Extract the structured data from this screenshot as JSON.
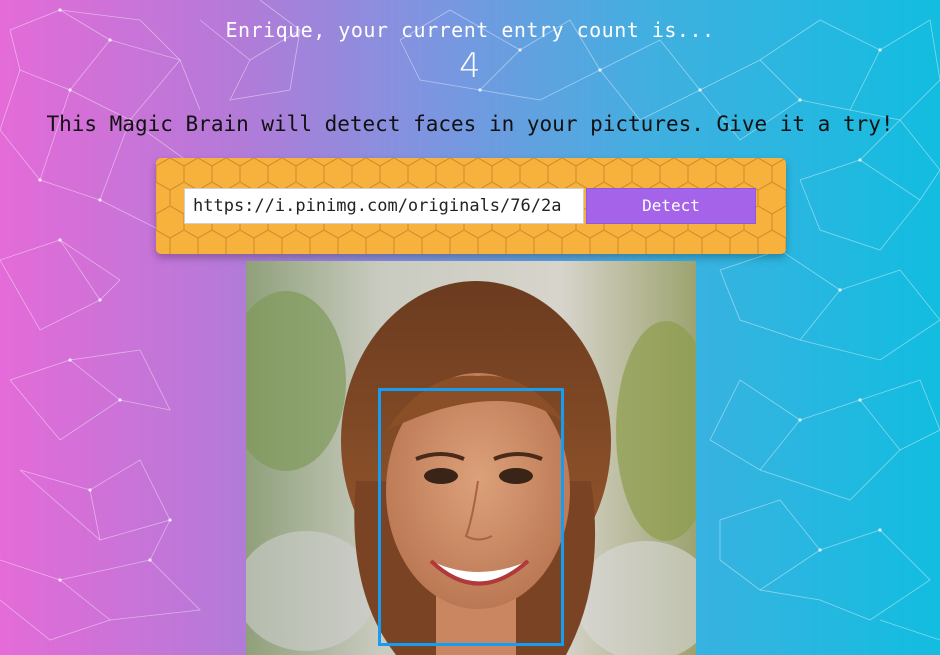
{
  "header": {
    "count_label": "Enrique, your current entry count is...",
    "count_value": "4"
  },
  "tagline": "This Magic Brain will detect faces in your pictures. Give it a try!",
  "form": {
    "url_value": "https://i.pinimg.com/originals/76/2a",
    "detect_label": "Detect"
  },
  "colors": {
    "panel": "#f7b13d",
    "button": "#a463e8",
    "face_box": "#149df2"
  },
  "image": {
    "subject": "portrait-photo",
    "faces_detected": 1
  }
}
